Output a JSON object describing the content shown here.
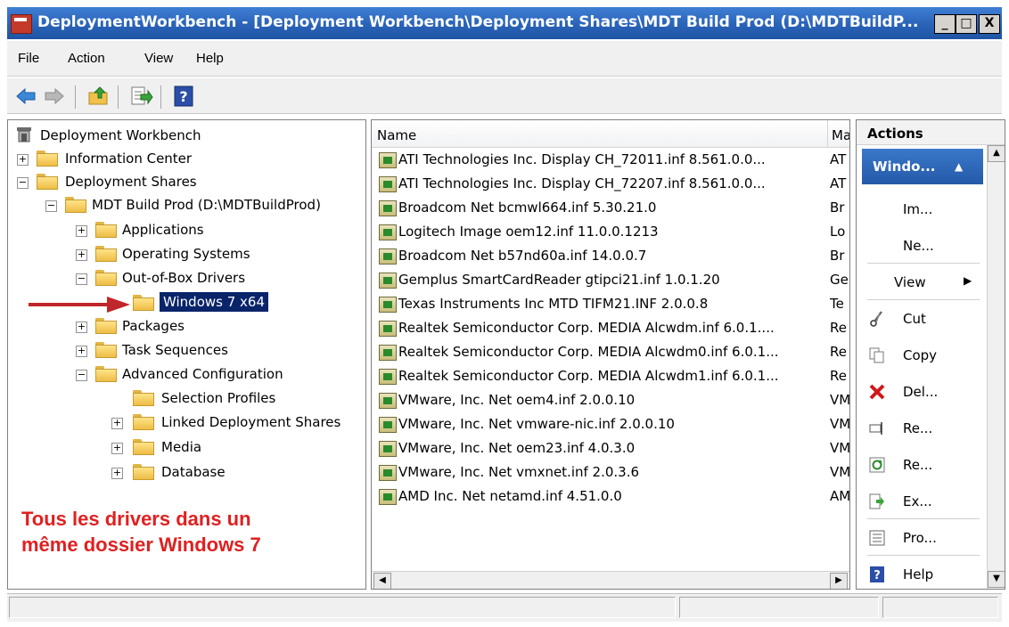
{
  "window": {
    "title": "DeploymentWorkbench - [Deployment Workbench\\Deployment Shares\\MDT Build Prod (D:\\MDTBuildP...",
    "min_label": "_",
    "max_label": "□",
    "close_label": "X"
  },
  "menu": {
    "file": "File",
    "action": "Action",
    "view": "View",
    "help": "Help"
  },
  "toolbar": {
    "icons": [
      "back-arrow-icon",
      "forward-arrow-icon",
      "up-folder-icon",
      "export-list-icon",
      "help-icon"
    ]
  },
  "tree": {
    "root": "Deployment Workbench",
    "information_center": "Information Center",
    "deployment_shares": "Deployment Shares",
    "mdt_build_prod": "MDT Build Prod (D:\\MDTBuildProd)",
    "applications": "Applications",
    "operating_systems": "Operating Systems",
    "out_of_box_drivers": "Out-of-Box Drivers",
    "windows7x64": "Windows 7 x64",
    "packages": "Packages",
    "task_sequences": "Task Sequences",
    "advanced_configuration": "Advanced Configuration",
    "selection_profiles": "Selection Profiles",
    "linked_deployment_shares": "Linked Deployment Shares",
    "media": "Media",
    "database": "Database",
    "expander_plus": "+",
    "expander_minus": "−"
  },
  "list": {
    "columns": [
      "Name",
      "Ma"
    ],
    "rows": [
      {
        "name": "ATI Technologies Inc. Display CH_72011.inf 8.561.0.0...",
        "manufacturer": "AT"
      },
      {
        "name": "ATI Technologies Inc. Display CH_72207.inf 8.561.0.0...",
        "manufacturer": "AT"
      },
      {
        "name": "Broadcom Net bcmwl664.inf 5.30.21.0",
        "manufacturer": "Br"
      },
      {
        "name": "Logitech Image oem12.inf 11.0.0.1213",
        "manufacturer": "Lo"
      },
      {
        "name": "Broadcom Net b57nd60a.inf 14.0.0.7",
        "manufacturer": "Br"
      },
      {
        "name": "Gemplus SmartCardReader gtipci21.inf 1.0.1.20",
        "manufacturer": "Ge"
      },
      {
        "name": "Texas Instruments Inc MTD TIFM21.INF 2.0.0.8",
        "manufacturer": "Te"
      },
      {
        "name": "Realtek Semiconductor Corp. MEDIA Alcwdm.inf 6.0.1....",
        "manufacturer": "Re"
      },
      {
        "name": "Realtek Semiconductor Corp. MEDIA Alcwdm0.inf 6.0.1...",
        "manufacturer": "Re"
      },
      {
        "name": "Realtek Semiconductor Corp. MEDIA Alcwdm1.inf 6.0.1...",
        "manufacturer": "Re"
      },
      {
        "name": "VMware, Inc. Net oem4.inf 2.0.0.10",
        "manufacturer": "VM"
      },
      {
        "name": "VMware, Inc. Net vmware-nic.inf 2.0.0.10",
        "manufacturer": "VM"
      },
      {
        "name": "VMware, Inc. Net oem23.inf 4.0.3.0",
        "manufacturer": "VM"
      },
      {
        "name": "VMware, Inc. Net vmxnet.inf 2.0.3.6",
        "manufacturer": "VM"
      },
      {
        "name": "AMD Inc. Net netamd.inf 4.51.0.0",
        "manufacturer": "AM"
      }
    ],
    "scroll_left": "◀",
    "scroll_right": "▶"
  },
  "actions": {
    "header": "Actions",
    "group": "Windo...",
    "group_chevron": "▲",
    "items": [
      {
        "label": "Im...",
        "icon": ""
      },
      {
        "label": "Ne...",
        "icon": ""
      },
      {
        "label": "View",
        "icon": "",
        "submenu": "▶"
      },
      {
        "label": "Cut",
        "icon": "scissors-icon"
      },
      {
        "label": "Copy",
        "icon": "copy-icon"
      },
      {
        "label": "Del...",
        "icon": "delete-x-icon"
      },
      {
        "label": "Re...",
        "icon": "rename-icon"
      },
      {
        "label": "Re...",
        "icon": "refresh-icon"
      },
      {
        "label": "Ex...",
        "icon": "export-list-icon"
      },
      {
        "label": "Pro...",
        "icon": "properties-icon"
      },
      {
        "label": "Help",
        "icon": "help-icon"
      }
    ],
    "scroll_up": "▲",
    "scroll_down": "▼"
  },
  "annotation": {
    "line1": "Tous les drivers dans un",
    "line2": "même dossier Windows 7"
  },
  "colors": {
    "annotation": "#e02020",
    "selection": "#0a246a",
    "titlebar": "#2a63b8"
  }
}
